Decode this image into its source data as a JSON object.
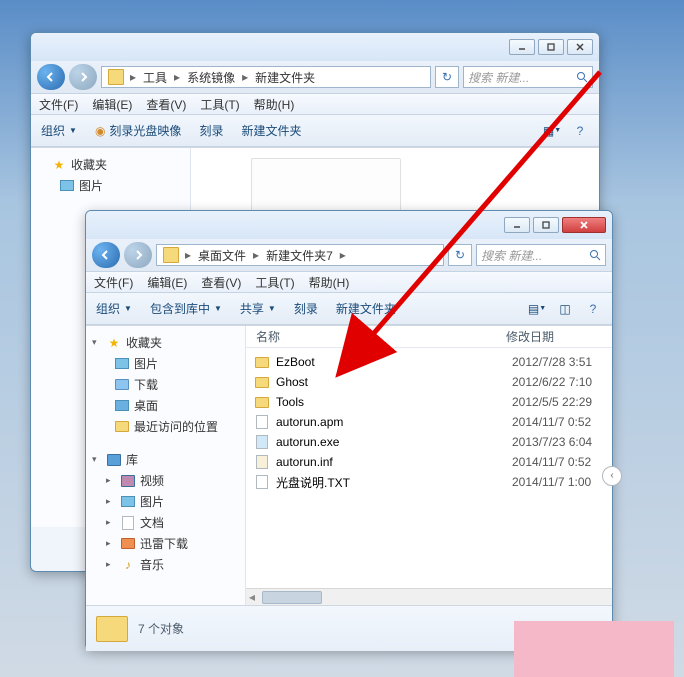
{
  "window1": {
    "breadcrumb": [
      "工具",
      "系统镜像",
      "新建文件夹"
    ],
    "search_placeholder": "搜索 新建...",
    "menubar": [
      "文件(F)",
      "编辑(E)",
      "查看(V)",
      "工具(T)",
      "帮助(H)"
    ],
    "toolbar": {
      "organize": "组织",
      "burn_image": "刻录光盘映像",
      "burn": "刻录",
      "new_folder": "新建文件夹"
    },
    "sidebar": {
      "favorites": "收藏夹",
      "pictures": "图片"
    }
  },
  "window2": {
    "breadcrumb": [
      "桌面文件",
      "新建文件夹7"
    ],
    "search_placeholder": "搜索 新建...",
    "menubar": [
      "文件(F)",
      "编辑(E)",
      "查看(V)",
      "工具(T)",
      "帮助(H)"
    ],
    "toolbar": {
      "organize": "组织",
      "include": "包含到库中",
      "share": "共享",
      "burn": "刻录",
      "new_folder": "新建文件夹"
    },
    "sidebar": {
      "favorites": "收藏夹",
      "fav_items": [
        "图片",
        "下载",
        "桌面",
        "最近访问的位置"
      ],
      "library": "库",
      "lib_items": [
        "视频",
        "图片",
        "文档",
        "迅雷下载",
        "音乐"
      ]
    },
    "columns": {
      "name": "名称",
      "date": "修改日期"
    },
    "files": [
      {
        "name": "EzBoot",
        "date": "2012/7/28 3:51",
        "type": "folder"
      },
      {
        "name": "Ghost",
        "date": "2012/6/22 7:10",
        "type": "folder"
      },
      {
        "name": "Tools",
        "date": "2012/5/5 22:29",
        "type": "folder"
      },
      {
        "name": "autorun.apm",
        "date": "2014/11/7 0:52",
        "type": "file"
      },
      {
        "name": "autorun.exe",
        "date": "2013/7/23 6:04",
        "type": "exe"
      },
      {
        "name": "autorun.inf",
        "date": "2014/11/7 0:52",
        "type": "inf"
      },
      {
        "name": "光盘说明.TXT",
        "date": "2014/11/7 1:00",
        "type": "txt"
      }
    ],
    "status": "7 个对象"
  }
}
